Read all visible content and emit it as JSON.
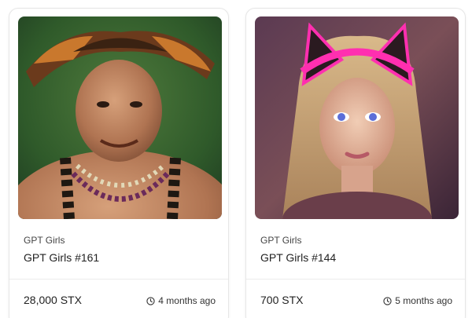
{
  "cards": [
    {
      "image_alt": "Man wearing feathered headdress and bead necklaces",
      "collection": "GPT Girls",
      "title": "GPT Girls #161",
      "price": "28,000 STX",
      "age": "4 months ago"
    },
    {
      "image_alt": "Woman with long blonde hair wearing glowing pink cat-ear headphones",
      "collection": "GPT Girls",
      "title": "GPT Girls #144",
      "price": "700 STX",
      "age": "5 months ago"
    }
  ],
  "icons": {
    "age": "clock-icon"
  },
  "colors": {
    "border": "#e6e6e6",
    "text_primary": "#222222",
    "text_secondary": "#444444",
    "neon_pink": "#ff2fb0"
  }
}
